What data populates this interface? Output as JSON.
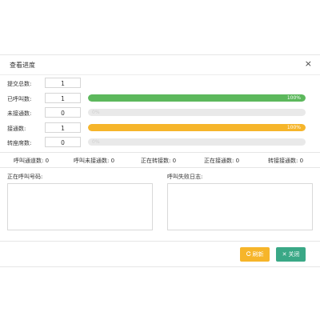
{
  "dialog": {
    "title": "查看进度",
    "close_glyph": "×"
  },
  "rows": [
    {
      "label": "提交总数:",
      "value": "1",
      "bar": null
    },
    {
      "label": "已呼叫数:",
      "value": "1",
      "bar": {
        "percent_text": "100%",
        "fraction": 1.0,
        "color": "#5cb85c"
      }
    },
    {
      "label": "未接通数:",
      "value": "0",
      "bar": {
        "percent_text": "0%",
        "fraction": 0.0,
        "color": "#5cb85c"
      }
    },
    {
      "label": "接通数:",
      "value": "1",
      "bar": {
        "percent_text": "100%",
        "fraction": 1.0,
        "color": "#f6b52a"
      }
    },
    {
      "label": "转座席数:",
      "value": "0",
      "bar": {
        "percent_text": "0%",
        "fraction": 0.0,
        "color": "#5cb85c"
      }
    }
  ],
  "stats": [
    "呼叫通道数: 0",
    "呼叫未接通数: 0",
    "正在转接数: 0",
    "正在接通数: 0",
    "转接接通数: 0"
  ],
  "panels": {
    "calling_numbers_label": "正在呼叫号码:",
    "fail_log_label": "呼叫失败日志:"
  },
  "buttons": {
    "refresh_label": "刷新",
    "refresh_icon": "refresh-icon",
    "refresh_color": "#f6b52a",
    "close_label": "关闭",
    "close_icon": "close-icon",
    "close_color": "#3aa886"
  }
}
